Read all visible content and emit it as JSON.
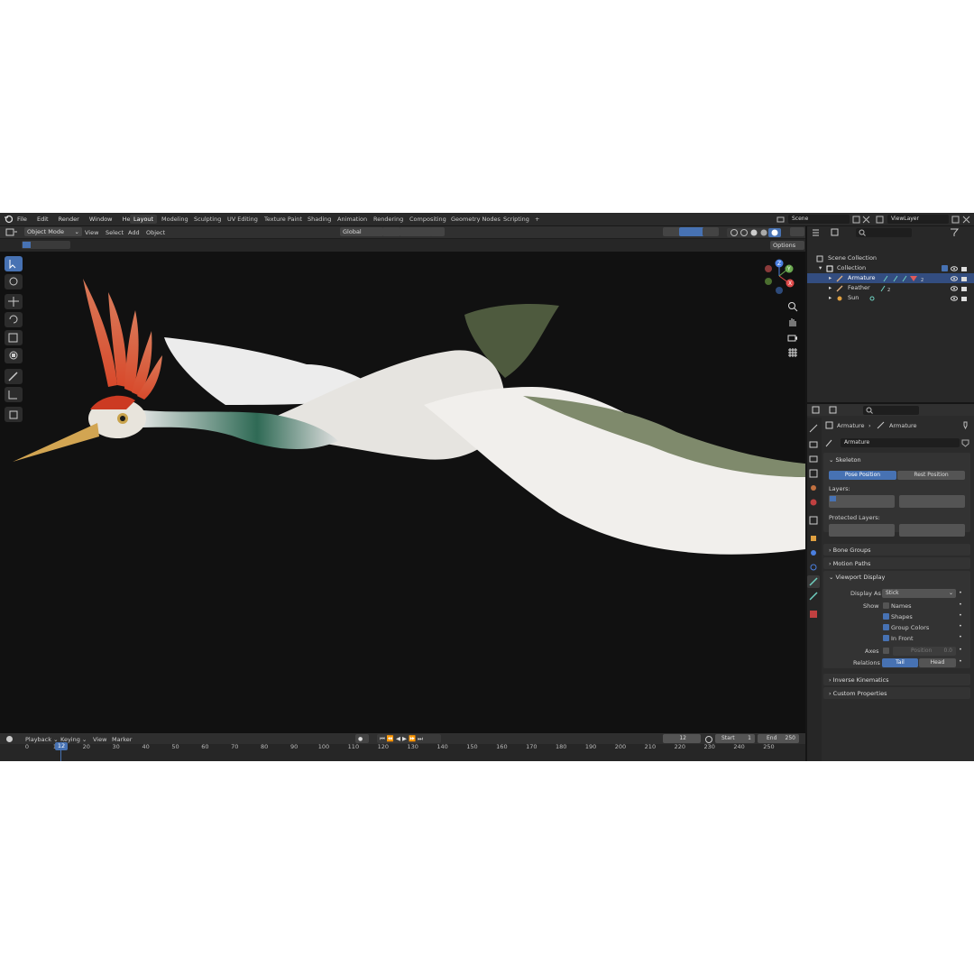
{
  "menu": [
    "File",
    "Edit",
    "Render",
    "Window",
    "Help"
  ],
  "workspaces": [
    "Layout",
    "Modeling",
    "Sculpting",
    "UV Editing",
    "Texture Paint",
    "Shading",
    "Animation",
    "Rendering",
    "Compositing",
    "Geometry Nodes",
    "Scripting"
  ],
  "add_workspace": "+",
  "scene": {
    "scene_name": "Scene",
    "view_layer": "ViewLayer"
  },
  "viewport_header": {
    "mode": "Object Mode",
    "menus": [
      "View",
      "Select",
      "Add",
      "Object"
    ],
    "orientation": "Global",
    "options": "Options"
  },
  "gizmo": {
    "x": "X",
    "y": "Y",
    "z": "Z"
  },
  "outliner": {
    "rows": [
      {
        "label": "Scene Collection"
      },
      {
        "label": "Collection"
      },
      {
        "label": "Armature"
      },
      {
        "label": "Feather"
      },
      {
        "label": "Sun"
      }
    ],
    "armature_count": "2",
    "feather_count": "2"
  },
  "properties": {
    "breadcrumb": [
      "Armature",
      "Armature"
    ],
    "data_name": "Armature",
    "skeleton": {
      "title": "Skeleton",
      "pose_position": "Pose Position",
      "rest_position": "Rest Position",
      "layers": "Layers:",
      "protected_layers": "Protected Layers:"
    },
    "bone_groups": "Bone Groups",
    "motion_paths": "Motion Paths",
    "viewport_display": {
      "title": "Viewport Display",
      "display_as_label": "Display As",
      "display_as_value": "Stick",
      "show_label": "Show",
      "names": "Names",
      "shapes": "Shapes",
      "group_colors": "Group Colors",
      "in_front": "In Front",
      "axes_label": "Axes",
      "position": "Position",
      "position_value": "0.0",
      "relations_label": "Relations",
      "tail": "Tail",
      "head": "Head"
    },
    "inverse_kinematics": "Inverse Kinematics",
    "custom_properties": "Custom Properties"
  },
  "timeline": {
    "menus": [
      "Playback",
      "Keying",
      "View",
      "Marker"
    ],
    "current_frame": "12",
    "start_label": "Start",
    "start": "1",
    "end_label": "End",
    "end": "250",
    "ticks": [
      "0",
      "10",
      "20",
      "30",
      "40",
      "50",
      "60",
      "70",
      "80",
      "90",
      "100",
      "110",
      "120",
      "130",
      "140",
      "150",
      "160",
      "170",
      "180",
      "190",
      "200",
      "210",
      "220",
      "230",
      "240",
      "250"
    ],
    "playhead": "12"
  },
  "colors": {
    "accent": "#4772b3",
    "selection": "#334d80",
    "viewport_bg": "#111111"
  }
}
